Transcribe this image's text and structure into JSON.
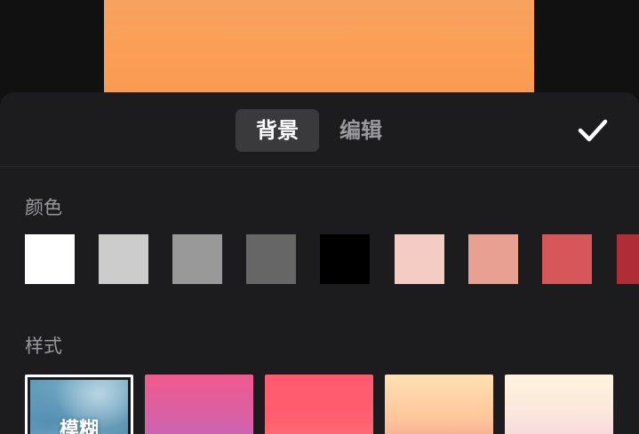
{
  "tabs": [
    {
      "label": "背景",
      "active": true
    },
    {
      "label": "编辑",
      "active": false
    }
  ],
  "confirm": {
    "icon": "check-icon"
  },
  "colors_section": {
    "label": "颜色",
    "swatches": [
      "#ffffff",
      "#cccccc",
      "#999999",
      "#666666",
      "#000000",
      "#f5ccc4",
      "#e8a092",
      "#d6565a",
      "#b02c36"
    ]
  },
  "styles_section": {
    "label": "样式",
    "items": [
      {
        "label": "模糊",
        "selected": true
      },
      {
        "label": ""
      },
      {
        "label": ""
      },
      {
        "label": ""
      },
      {
        "label": ""
      }
    ]
  }
}
